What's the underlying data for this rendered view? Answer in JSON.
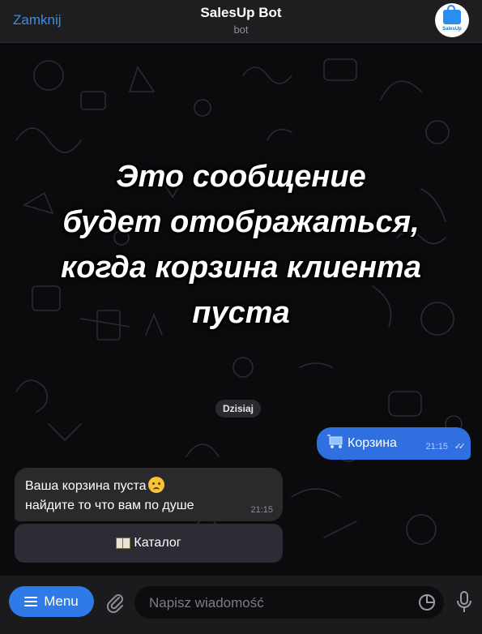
{
  "header": {
    "close_label": "Zamknij",
    "title": "SalesUp Bot",
    "subtitle": "bot",
    "avatar_text": "SalesUp"
  },
  "overlay": {
    "lines": [
      "Это сообщение",
      "будет отображаться,",
      "когда корзина клиента",
      "пуста"
    ]
  },
  "chat": {
    "date_label": "Dzisiaj",
    "outgoing": {
      "text": "Корзина",
      "time": "21:15",
      "icon": "shopping-cart-icon",
      "status": "read"
    },
    "incoming": {
      "line1": "Ваша корзина пуста",
      "line2": "найдите то что вам по душе",
      "time": "21:15",
      "emoji": "crying-face-icon"
    },
    "keyboard_button": {
      "label": "Каталог",
      "icon": "book-icon"
    }
  },
  "input_bar": {
    "menu_label": "Menu",
    "placeholder": "Napisz wiadomość"
  },
  "colors": {
    "accent": "#2e7ae6",
    "outgoing_bubble": "#2f6fe0",
    "incoming_bubble": "#2a2a2d",
    "header_bg": "#1e1e21",
    "link": "#3a8ee8"
  }
}
